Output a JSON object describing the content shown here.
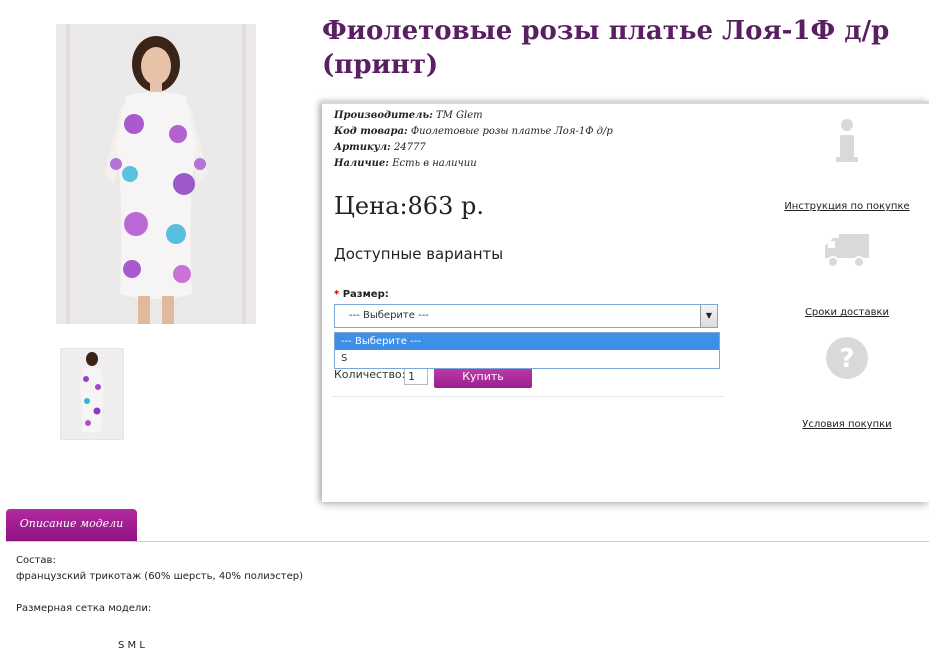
{
  "product": {
    "title": "Фиолетовые розы платье Лоя-1Ф д/р (принт)",
    "meta": {
      "manufacturer_label": "Производитель:",
      "manufacturer_value": "TM Glem",
      "code_label": "Код товара:",
      "code_value": "Фиолетовые розы платье Лоя-1Ф д/р",
      "sku_label": "Артикул:",
      "sku_value": "24777",
      "stock_label": "Наличие:",
      "stock_value": "Есть в наличии"
    },
    "price": "Цена:863 р.",
    "variants_heading": "Доступные варианты",
    "size": {
      "required_mark": "*",
      "label": "Размер:",
      "selected": "--- Выберите ---",
      "options": [
        "--- Выберите ---",
        "S"
      ]
    },
    "quantity_label": "Количество:",
    "quantity_value": "1",
    "buy_label": "Купить"
  },
  "side_links": {
    "instructions": "Инструкция по покупке",
    "delivery": "Сроки доставки",
    "terms": "Условия покупки"
  },
  "tabs": {
    "description": "Описание модели"
  },
  "description": {
    "composition_label": "Состав:",
    "composition_value": "французский трикотаж (60% шерсть, 40% полиэстер)",
    "size_chart_label": "Размерная сетка модели:",
    "sizes": "S  M  L"
  },
  "colors": {
    "title": "#5a1f63",
    "accent": "#a0228f",
    "dropdown_highlight": "#3d8fe8"
  }
}
